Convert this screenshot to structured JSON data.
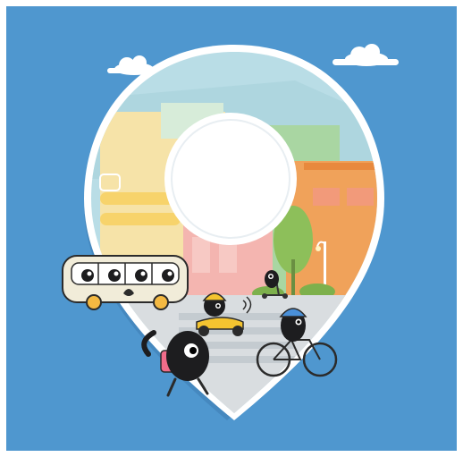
{
  "illustration": {
    "subject": "map-pin",
    "colors": {
      "background": "#4f97cf",
      "pin_outline": "#ffffff",
      "pin_shadow": "#3f7fb4",
      "sky": "#b9dde6",
      "road": "#d9dde0",
      "crosswalk": "#c4cbd0",
      "bus": "#f1ecd9",
      "scooter": "#f4c430",
      "tree": "#8dbf5a",
      "building_orange": "#f0a25a",
      "building_yellow": "#f7d36b",
      "building_pink": "#f4b5b0",
      "character_body": "#1d1d1f"
    },
    "elements": [
      "cloud-icon",
      "cloud-icon",
      "building-icon",
      "tree-icon",
      "street-lamp-icon",
      "bus-icon",
      "scooter-icon",
      "bicycle-icon",
      "kick-scooter-icon",
      "pedestrian-icon",
      "leaf-icon"
    ]
  }
}
